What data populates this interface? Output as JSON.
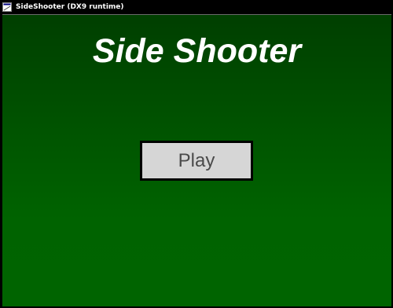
{
  "window": {
    "title": "SideShooter (DX9 runtime)",
    "icon": "app-window-icon"
  },
  "game": {
    "title": "Side Shooter",
    "play_label": "Play"
  },
  "colors": {
    "background_top": "#003f00",
    "background_bottom": "#006400",
    "button_face": "#d6d6d6",
    "button_border": "#000000",
    "button_text": "#4a4a4a",
    "title_text": "#ffffff"
  }
}
